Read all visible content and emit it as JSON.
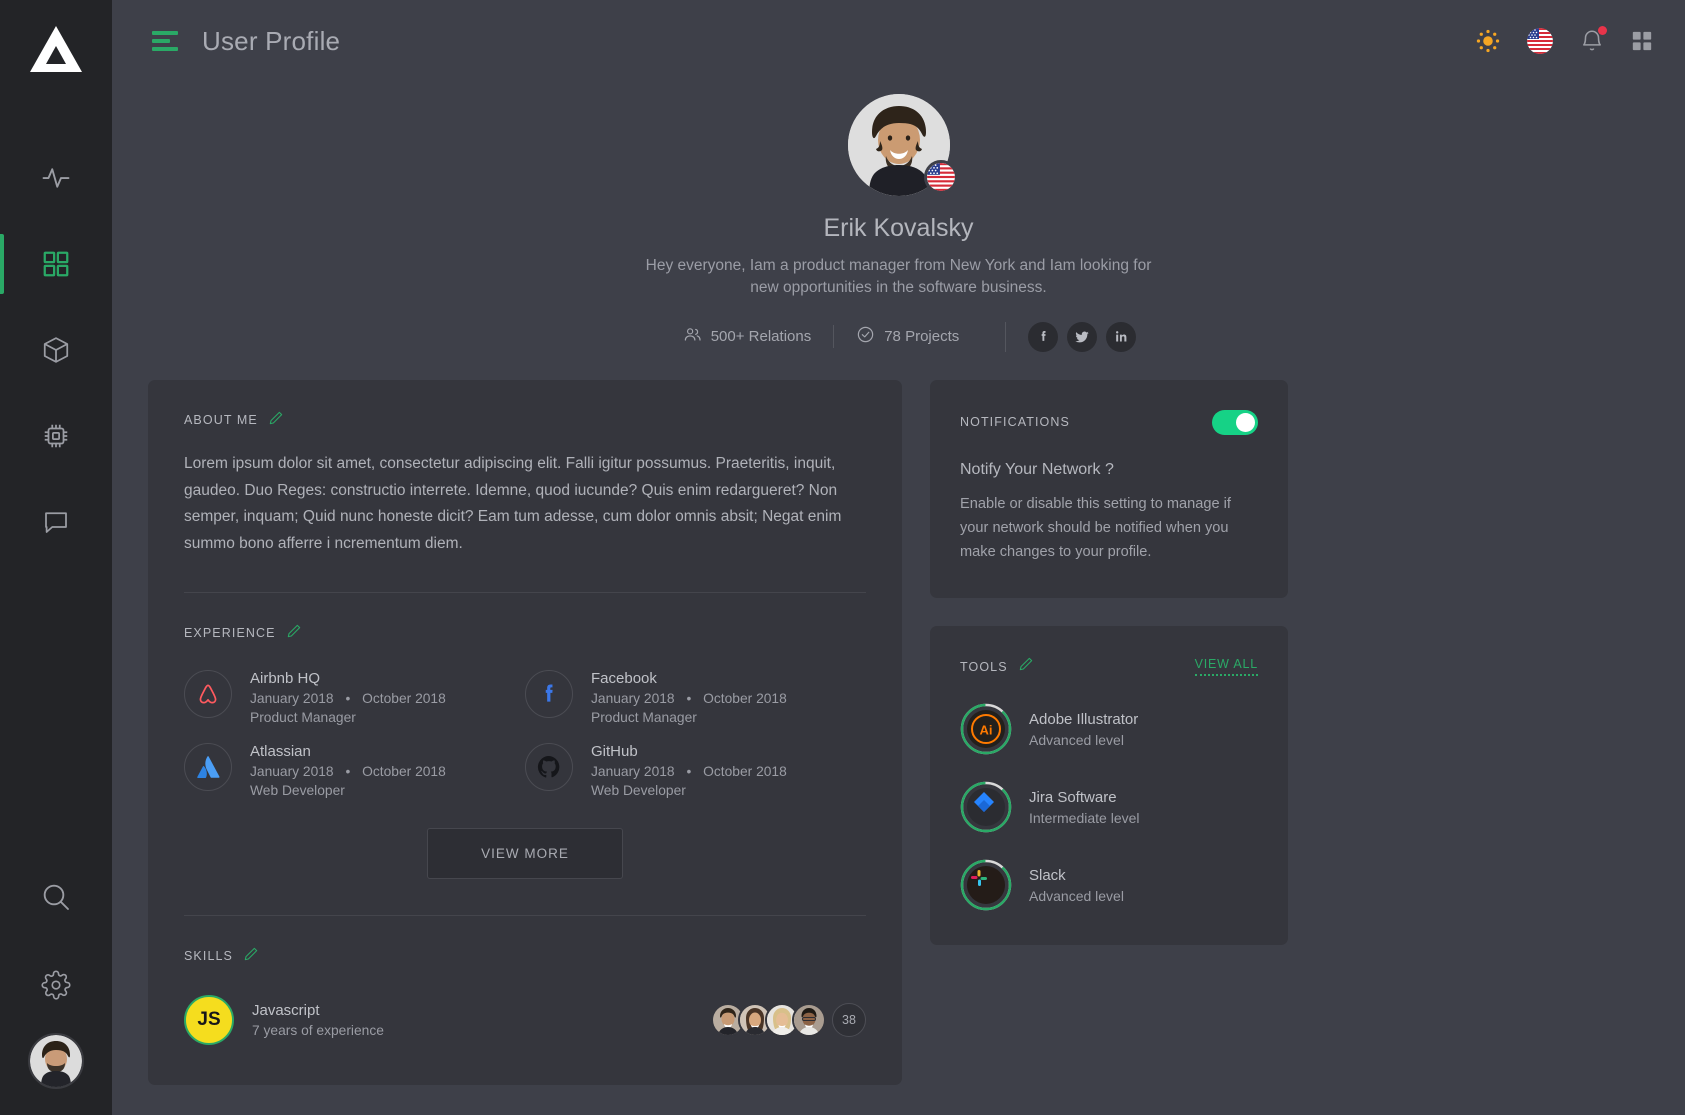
{
  "sidebar": {
    "logo_name": "triangle-logo",
    "items": [
      {
        "name": "activity",
        "icon": "activity-icon",
        "active": false
      },
      {
        "name": "dashboard",
        "icon": "grid-icon",
        "active": true
      },
      {
        "name": "packages",
        "icon": "cube-icon",
        "active": false
      },
      {
        "name": "hardware",
        "icon": "chip-icon",
        "active": false
      },
      {
        "name": "messages",
        "icon": "chat-icon",
        "active": false
      }
    ],
    "bottom_items": [
      {
        "name": "search",
        "icon": "search-icon"
      },
      {
        "name": "settings",
        "icon": "gear-icon"
      }
    ],
    "avatar_name": "user-avatar"
  },
  "topbar": {
    "menu_icon": "hamburger-icon",
    "title": "User Profile",
    "icons": [
      {
        "name": "theme-toggle",
        "icon": "sun-icon"
      },
      {
        "name": "language",
        "icon": "us-flag-icon"
      },
      {
        "name": "notifications",
        "icon": "bell-icon",
        "badge": true
      },
      {
        "name": "apps",
        "icon": "grid-apps-icon"
      }
    ]
  },
  "profile": {
    "name": "Erik Kovalsky",
    "bio": "Hey everyone,  Iam a product manager from New York and Iam looking for new opportunities in the software business.",
    "country_flag": "us-flag-icon",
    "stats": [
      {
        "icon": "people-icon",
        "label": "500+ Relations"
      },
      {
        "icon": "check-circle-icon",
        "label": "78 Projects"
      }
    ],
    "socials": [
      {
        "name": "facebook",
        "icon": "facebook-icon"
      },
      {
        "name": "twitter",
        "icon": "twitter-icon"
      },
      {
        "name": "linkedin",
        "icon": "linkedin-icon"
      }
    ]
  },
  "about": {
    "title": "ABOUT ME",
    "edit_icon": "pencil-icon",
    "text": "Lorem ipsum dolor sit amet, consectetur adipiscing elit. Falli igitur possumus. Praeteritis, inquit, gaudeo. Duo Reges: constructio interrete. Idemne, quod iucunde? Quis enim redargueret? Non semper, inquam; Quid nunc honeste dicit? Eam tum adesse, cum dolor omnis absit; Negat enim summo bono afferre i ncrementum diem."
  },
  "experience": {
    "title": "EXPERIENCE",
    "edit_icon": "pencil-icon",
    "items": [
      {
        "company": "Airbnb HQ",
        "start": "January 2018",
        "end": "October 2018",
        "role": "Product Manager",
        "logo": "airbnb-icon"
      },
      {
        "company": "Facebook",
        "start": "January 2018",
        "end": "October 2018",
        "role": "Product Manager",
        "logo": "facebook-icon"
      },
      {
        "company": "Atlassian",
        "start": "January 2018",
        "end": "October 2018",
        "role": "Web Developer",
        "logo": "atlassian-icon"
      },
      {
        "company": "GitHub",
        "start": "January 2018",
        "end": "October 2018",
        "role": "Web Developer",
        "logo": "github-icon"
      }
    ],
    "view_more_label": "VIEW MORE"
  },
  "skills": {
    "title": "SKILLS",
    "edit_icon": "pencil-icon",
    "items": [
      {
        "name": "Javascript",
        "experience": "7 years of experience",
        "logo_text": "JS",
        "logo_bg": "#f5dd1e",
        "ring": "#2aa966"
      }
    ],
    "people_count": "38",
    "people_avatars": [
      "person-1",
      "person-2",
      "person-3",
      "person-4"
    ]
  },
  "notifications": {
    "title": "NOTIFICATIONS",
    "enabled": true,
    "toggle_color": "#16d286",
    "question": "Notify Your Network ?",
    "description": "Enable or disable this setting to manage if your network should be notified when you make changes to your profile."
  },
  "tools": {
    "title": "TOOLS",
    "edit_icon": "pencil-icon",
    "view_all_label": "VIEW ALL",
    "items": [
      {
        "name": "Adobe Illustrator",
        "level": "Advanced level",
        "logo": "adobe-illustrator-icon",
        "progress": 88
      },
      {
        "name": "Jira Software",
        "level": "Intermediate level",
        "logo": "jira-icon",
        "progress": 88
      },
      {
        "name": "Slack",
        "level": "Advanced level",
        "logo": "slack-icon",
        "progress": 88
      }
    ]
  },
  "theme": {
    "accent": "#2aa966",
    "page_bg": "#3e4049",
    "sidebar_bg": "#232427",
    "card_bg": "#35363d"
  }
}
